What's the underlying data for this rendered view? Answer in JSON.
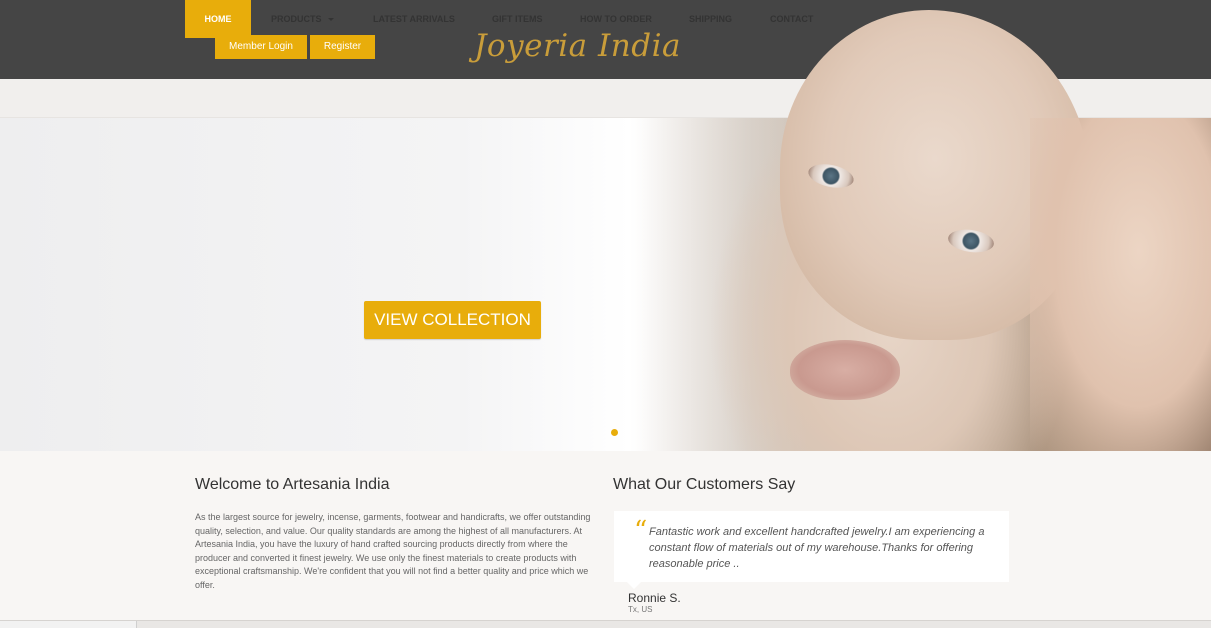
{
  "header": {
    "member_login": "Member Login",
    "register": "Register",
    "logo_text": "Joyeria India"
  },
  "nav": {
    "items": [
      {
        "label": "HOME"
      },
      {
        "label": "PRODUCTS"
      },
      {
        "label": "LATEST ARRIVALS"
      },
      {
        "label": "GIFT ITEMS"
      },
      {
        "label": "HOW TO ORDER"
      },
      {
        "label": "SHIPPING"
      },
      {
        "label": "CONTACT"
      }
    ],
    "search_icon": "search-icon"
  },
  "hero": {
    "cta_label": "VIEW COLLECTION",
    "slide_count": 1,
    "active_slide": 1
  },
  "welcome": {
    "title": "Welcome to Artesania India",
    "body": "As the largest source for jewelry, incense, garments, footwear and handicrafts, we offer outstanding quality, selection, and value. Our quality standards are among the highest of all manufacturers. At Artesania India, you have the luxury of hand crafted sourcing products directly from where the producer and converted it finest jewelry. We use only the finest materials to create products with exceptional craftsmanship. We're confident that you will not find a better quality and price which we offer."
  },
  "testimonials": {
    "title": "What Our Customers Say",
    "quote": "Fantastic work and excellent handcrafted jewelry.I am experiencing a constant flow of materials out of my warehouse.Thanks for offering reasonable price ..",
    "author": "Ronnie S.",
    "location": "Tx, US"
  },
  "colors": {
    "accent": "#e8ad0b",
    "topbar": "#454545",
    "logo": "#c99d3a"
  }
}
